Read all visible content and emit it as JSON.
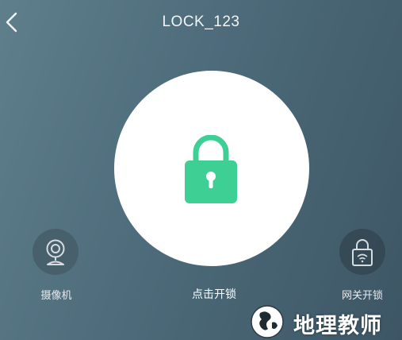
{
  "header": {
    "title": "LOCK_123",
    "back_icon": "chevron-left-icon"
  },
  "main": {
    "unlock_button": {
      "icon": "padlock-icon",
      "label": "点击开锁",
      "accent_color": "#3dcf94"
    }
  },
  "side_actions": {
    "camera": {
      "icon": "webcam-icon",
      "label": "摄像机"
    },
    "gateway_unlock": {
      "icon": "wifi-lock-icon",
      "label": "网关开锁"
    }
  },
  "watermark": {
    "text": "地理教师",
    "icon": "globe-icon"
  }
}
